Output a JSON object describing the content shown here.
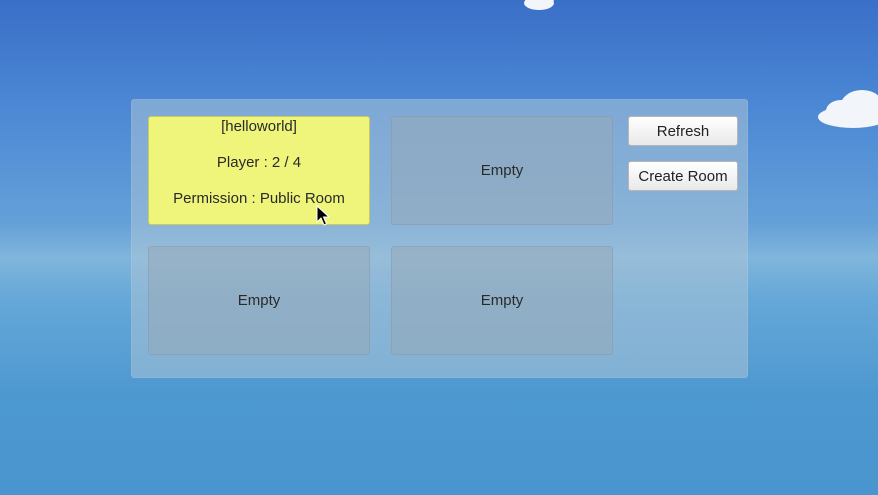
{
  "rooms": [
    {
      "name": "[helloworld]",
      "players": "Player : 2 / 4",
      "permission": "Permission : Public Room"
    },
    {
      "label": "Empty"
    },
    {
      "label": "Empty"
    },
    {
      "label": "Empty"
    }
  ],
  "buttons": {
    "refresh": "Refresh",
    "create_room": "Create Room"
  },
  "colors": {
    "active_room": "#eef57a",
    "empty_room": "#96aab9",
    "panel": "#aac3d7",
    "sky_top": "#3a6fc8",
    "sky_bottom": "#4a95cf"
  },
  "icons": {
    "cursor": "mouse-pointer-icon"
  }
}
